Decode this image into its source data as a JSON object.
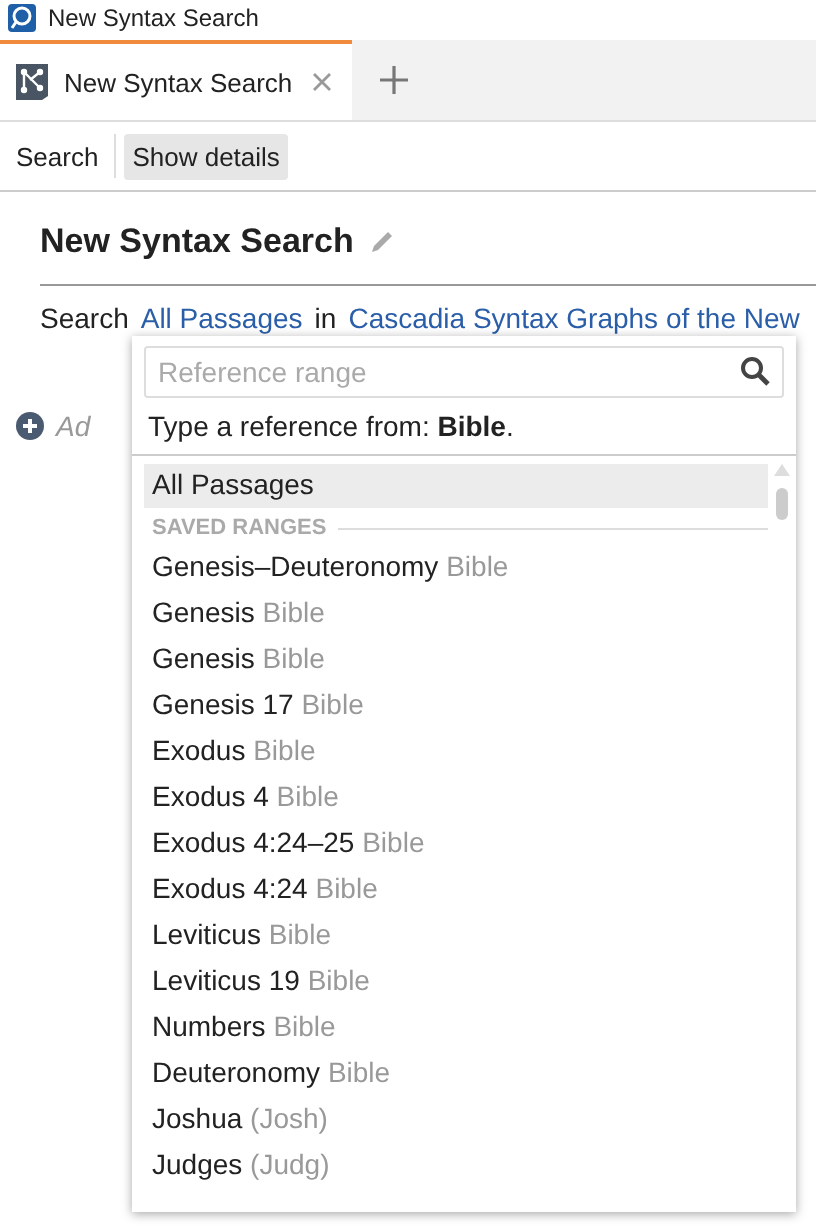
{
  "window": {
    "title": "New Syntax Search"
  },
  "tabs": [
    {
      "label": "New Syntax Search",
      "selected": true
    }
  ],
  "toolbar": {
    "items": [
      {
        "label": "Search",
        "pressed": false
      },
      {
        "label": "Show details",
        "pressed": true
      }
    ]
  },
  "heading": "New Syntax Search",
  "scope": {
    "prefix": "Search",
    "range": "All Passages",
    "joiner": "in",
    "resource": "Cascadia Syntax Graphs of the New"
  },
  "add_hint": "Ad",
  "dropdown": {
    "search": {
      "placeholder": "Reference range"
    },
    "hint": "Type a reference from: **Bible**.",
    "top_item": {
      "label": "All Passages",
      "selected": true
    },
    "section": "SAVED RANGES",
    "items": [
      {
        "name": "Genesis–Deuteronomy",
        "source": "Bible"
      },
      {
        "name": "Genesis",
        "source": "Bible"
      },
      {
        "name": "Genesis",
        "source": "Bible"
      },
      {
        "name": "Genesis 17",
        "source": "Bible"
      },
      {
        "name": "Exodus",
        "source": "Bible"
      },
      {
        "name": "Exodus 4",
        "source": "Bible"
      },
      {
        "name": "Exodus 4:24–25",
        "source": "Bible"
      },
      {
        "name": "Exodus 4:24",
        "source": "Bible"
      },
      {
        "name": "Leviticus",
        "source": "Bible"
      },
      {
        "name": "Leviticus 19",
        "source": "Bible"
      },
      {
        "name": "Numbers",
        "source": "Bible"
      },
      {
        "name": "Deuteronomy",
        "source": "Bible"
      },
      {
        "name": "Joshua",
        "source": "(Josh)"
      },
      {
        "name": "Judges",
        "source": "(Judg)"
      }
    ]
  }
}
